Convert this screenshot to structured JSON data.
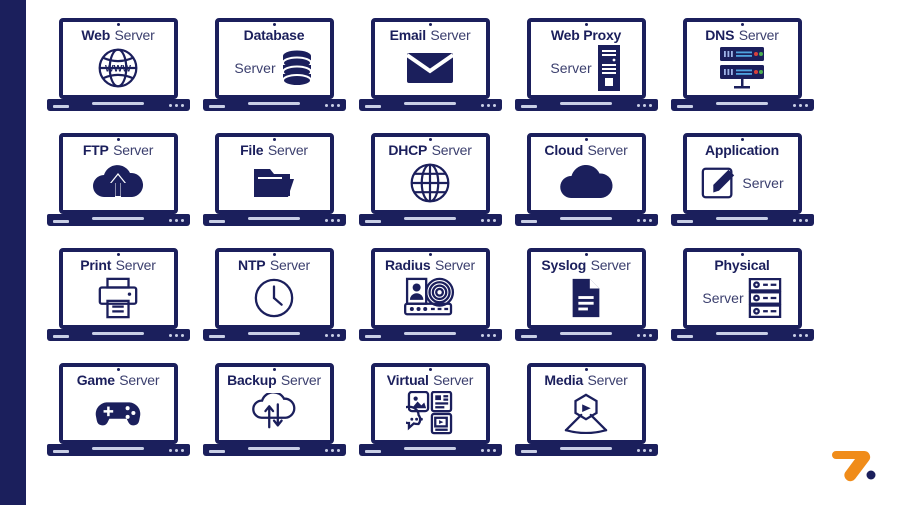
{
  "page": {
    "background_color": "#ffffff",
    "accent_navy": "#1b1f5c",
    "accent_orange": "#f08c1a",
    "text_secondary": "#3b3f6e"
  },
  "left_bar": {
    "color": "#1b1f5c"
  },
  "logo": {
    "name": "brand-logo-7",
    "mark": "7",
    "dot_color": "#1b1f5c",
    "mark_color": "#f08c1a"
  },
  "grid": {
    "rows": 4,
    "columns": 5,
    "cards": [
      {
        "bold": "Web",
        "plain": "Server",
        "icon": "globe-www-icon",
        "layout": "inline",
        "stack": false
      },
      {
        "bold": "Database",
        "plain": "Server",
        "icon": "database-stack-icon",
        "layout": "side",
        "stack": true
      },
      {
        "bold": "Email",
        "plain": "Server",
        "icon": "envelope-icon",
        "layout": "inline",
        "stack": false
      },
      {
        "bold": "Web Proxy",
        "plain": "Server",
        "icon": "server-tower-icon",
        "layout": "side",
        "stack": true
      },
      {
        "bold": "DNS",
        "plain": "Server",
        "icon": "rack-servers-icon",
        "layout": "inline",
        "stack": false
      },
      {
        "bold": "FTP",
        "plain": "Server",
        "icon": "cloud-upload-icon",
        "layout": "inline",
        "stack": false
      },
      {
        "bold": "File",
        "plain": "Server",
        "icon": "folder-open-icon",
        "layout": "inline",
        "stack": false
      },
      {
        "bold": "DHCP",
        "plain": "Server",
        "icon": "globe-grid-icon",
        "layout": "inline",
        "stack": false
      },
      {
        "bold": "Cloud",
        "plain": "Server",
        "icon": "cloud-icon",
        "layout": "inline",
        "stack": false
      },
      {
        "bold": "Application",
        "plain": "Server",
        "icon": "note-pencil-icon",
        "layout": "side",
        "stack": true
      },
      {
        "bold": "Print",
        "plain": "Server",
        "icon": "printer-icon",
        "layout": "inline",
        "stack": false
      },
      {
        "bold": "NTP",
        "plain": "Server",
        "icon": "clock-icon",
        "layout": "inline",
        "stack": false
      },
      {
        "bold": "Radius",
        "plain": "Server",
        "icon": "id-fingerprint-icon",
        "layout": "inline",
        "stack": false
      },
      {
        "bold": "Syslog",
        "plain": "Server",
        "icon": "document-lines-icon",
        "layout": "inline",
        "stack": false
      },
      {
        "bold": "Physical",
        "plain": "Server",
        "icon": "server-rack-icon",
        "layout": "side",
        "stack": true
      },
      {
        "bold": "Game",
        "plain": "Server",
        "icon": "gamepad-icon",
        "layout": "inline",
        "stack": false
      },
      {
        "bold": "Backup",
        "plain": "Server",
        "icon": "cloud-sync-icon",
        "layout": "inline",
        "stack": false
      },
      {
        "bold": "Virtual",
        "plain": "Server",
        "icon": "media-tiles-icon",
        "layout": "inline",
        "stack": false
      },
      {
        "bold": "Media",
        "plain": "Server",
        "icon": "media-hub-icon",
        "layout": "inline",
        "stack": false
      }
    ]
  }
}
